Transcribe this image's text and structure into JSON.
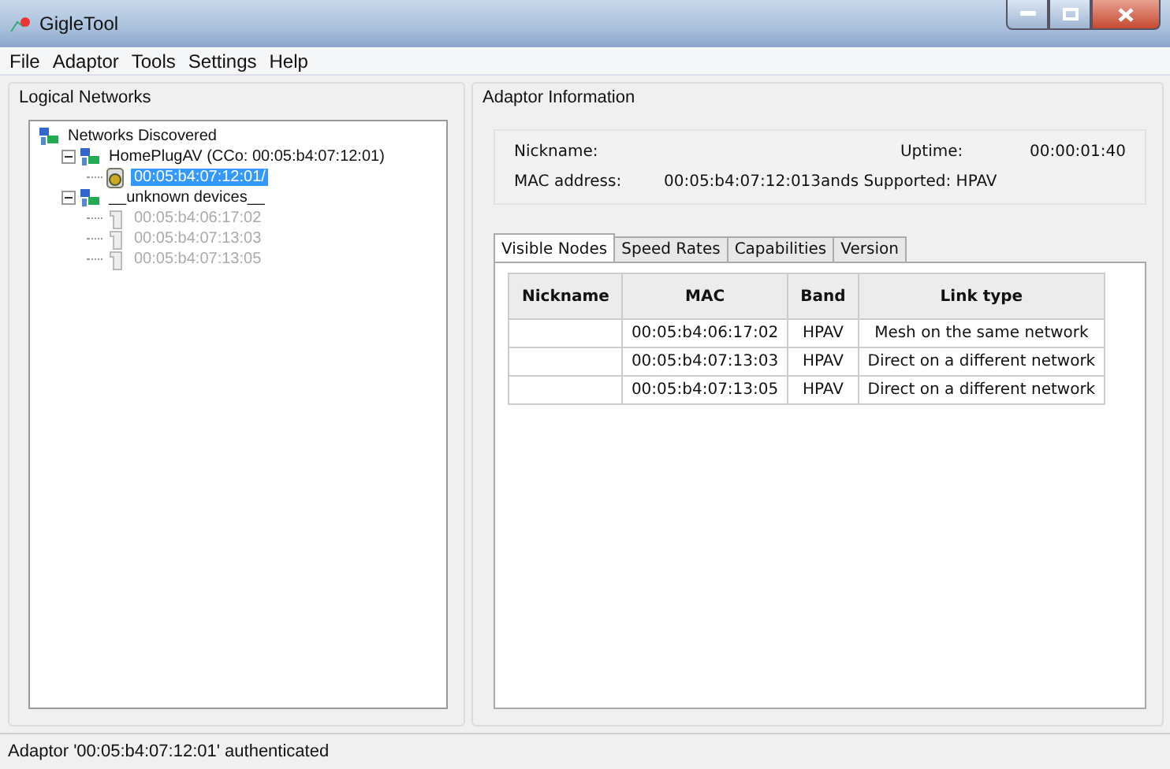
{
  "window": {
    "title": "GigleTool"
  },
  "menu": [
    "File",
    "Adaptor",
    "Tools",
    "Settings",
    "Help"
  ],
  "logical_networks": {
    "title": "Logical Networks",
    "tree": [
      {
        "label": "Networks Discovered",
        "kind": "root",
        "selected": false,
        "disabled": false,
        "children": [
          {
            "label": "HomePlugAV (CCo: 00:05:b4:07:12:01)",
            "kind": "network",
            "expanded": true,
            "selected": false,
            "disabled": false,
            "children": [
              {
                "label": "00:05:b4:07:12:01/",
                "kind": "adaptor",
                "selected": true,
                "disabled": false
              }
            ]
          },
          {
            "label": "__unknown devices__",
            "kind": "network",
            "expanded": true,
            "selected": false,
            "disabled": false,
            "children": [
              {
                "label": "00:05:b4:06:17:02",
                "kind": "device",
                "selected": false,
                "disabled": true
              },
              {
                "label": "00:05:b4:07:13:03",
                "kind": "device",
                "selected": false,
                "disabled": true
              },
              {
                "label": "00:05:b4:07:13:05",
                "kind": "device",
                "selected": false,
                "disabled": true
              }
            ]
          }
        ]
      }
    ]
  },
  "adaptor_information": {
    "title": "Adaptor Information",
    "nickname_label": "Nickname:",
    "uptime_label": "Uptime:",
    "uptime": "00:00:01:40",
    "mac_label": "MAC address:",
    "mac": "00:05:b4:07:12:013ands Supported: HPAV",
    "tabs": [
      {
        "label": "Visible Nodes",
        "selected": true
      },
      {
        "label": "Speed Rates",
        "selected": false
      },
      {
        "label": "Capabilities",
        "selected": false
      },
      {
        "label": "Version",
        "selected": false
      }
    ],
    "table": {
      "columns": [
        "Nickname",
        "MAC",
        "Band",
        "Link type"
      ],
      "rows": [
        [
          "",
          "00:05:b4:06:17:02",
          "HPAV",
          "Mesh on the same network"
        ],
        [
          "",
          "00:05:b4:07:13:03",
          "HPAV",
          "Direct on a different network"
        ],
        [
          "",
          "00:05:b4:07:13:05",
          "HPAV",
          "Direct on a different network"
        ]
      ]
    }
  },
  "status_bar": "Adaptor '00:05:b4:07:12:01' authenticated"
}
